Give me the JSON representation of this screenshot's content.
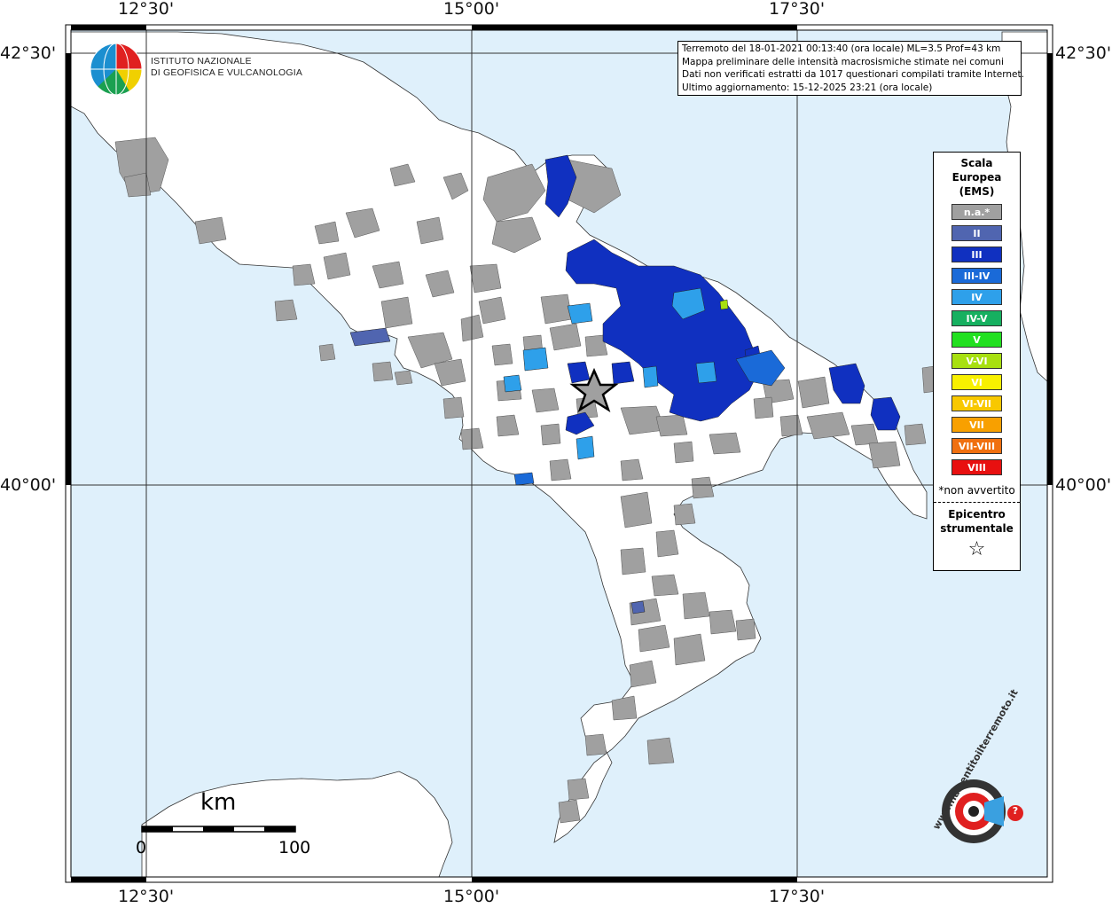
{
  "coords": {
    "lon_labels": [
      "12°30'",
      "15°00'",
      "17°30'"
    ],
    "lat_labels": [
      "42°30'",
      "40°00'"
    ]
  },
  "info": {
    "line1": "Terremoto del 18-01-2021 00:13:40 (ora locale) ML=3.5 Prof=43 km",
    "line2": "Mappa preliminare delle intensità macrosismiche stimate nei comuni",
    "line3": "Dati non verificati estratti da 1017 questionari compilati tramite Internet.",
    "line4": "Ultimo aggiornamento: 15-12-2025 23:21 (ora locale)"
  },
  "logo": {
    "line1": "ISTITUTO NAZIONALE",
    "line2": "DI GEOFISICA E VULCANOLOGIA"
  },
  "legend": {
    "title1": "Scala",
    "title2": "Europea",
    "title3": "(EMS)",
    "items": [
      {
        "label": "n.a.*",
        "color": "#a0a0a0"
      },
      {
        "label": "II",
        "color": "#5065b0"
      },
      {
        "label": "III",
        "color": "#1030c0"
      },
      {
        "label": "III-IV",
        "color": "#1a6ad8"
      },
      {
        "label": "IV",
        "color": "#2ea0ea"
      },
      {
        "label": "IV-V",
        "color": "#16b060"
      },
      {
        "label": "V",
        "color": "#22e020"
      },
      {
        "label": "V-VI",
        "color": "#a8e010"
      },
      {
        "label": "VI",
        "color": "#f8f000"
      },
      {
        "label": "VI-VII",
        "color": "#f8c800"
      },
      {
        "label": "VII",
        "color": "#f8a000"
      },
      {
        "label": "VII-VIII",
        "color": "#f07010"
      },
      {
        "label": "VIII",
        "color": "#e81010"
      }
    ],
    "note": "*non avvertito",
    "epi_title1": "Epicentro",
    "epi_title2": "strumentale",
    "epi_symbol": "☆"
  },
  "scale": {
    "unit": "km",
    "label_0": "0",
    "label_100": "100"
  },
  "brand": {
    "text": "www.haisentitoilterremoto.it",
    "badge": "?"
  },
  "colors": {
    "sea": "#dff0fb",
    "land": "#ffffff",
    "na": "#a0a0a0",
    "ems_ii": "#5065b0",
    "ems_iii": "#1030c0",
    "ems_iii_iv": "#1a6ad8",
    "ems_iv": "#2ea0ea"
  }
}
